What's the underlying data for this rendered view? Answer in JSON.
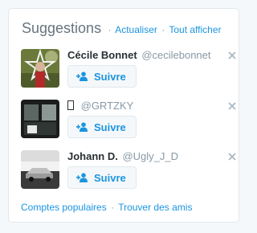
{
  "header": {
    "title": "Suggestions",
    "refresh_label": "Actualiser",
    "separator": "·",
    "view_all_label": "Tout afficher"
  },
  "suggestions": [
    {
      "name": "Cécile Bonnet",
      "handle": "@cecilebonnet",
      "follow_label": "Suivre",
      "avatar": "person-with-star-photo"
    },
    {
      "name": "",
      "handle": "@GRTZKY",
      "follow_label": "Suivre",
      "avatar": "dark-window-photo"
    },
    {
      "name": "Johann D.",
      "handle": "@Ugly_J_D",
      "follow_label": "Suivre",
      "avatar": "car-on-road-photo"
    }
  ],
  "footer": {
    "popular_label": "Comptes populaires",
    "separator": "·",
    "find_friends_label": "Trouver des amis"
  },
  "colors": {
    "link": "#1b95e0",
    "title": "#66757f",
    "muted": "#8899a6",
    "name": "#292f33",
    "border": "#e1e8ed",
    "button_bg": "#f5f8fa"
  }
}
